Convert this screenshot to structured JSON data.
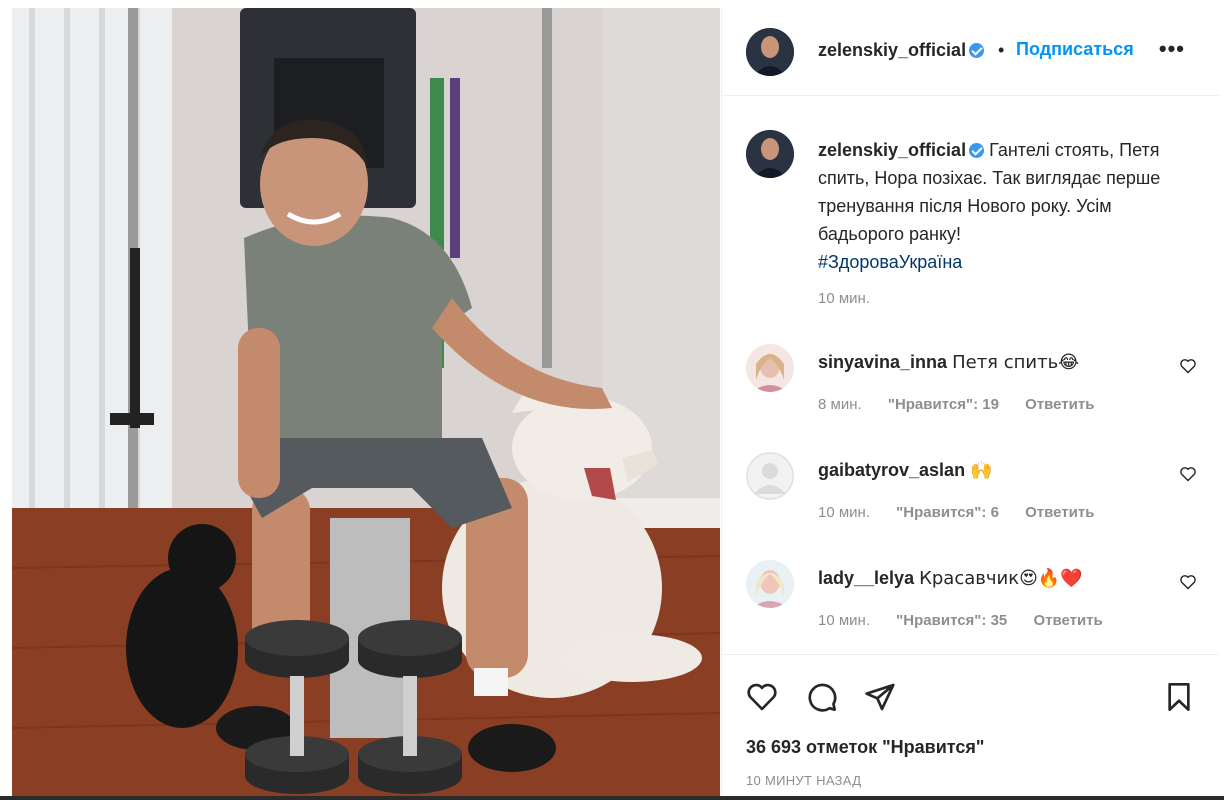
{
  "post": {
    "username": "zelenskiy_official",
    "separator": "•",
    "follow_label": "Подписаться",
    "more_label": "•••"
  },
  "caption": {
    "username": "zelenskiy_official",
    "text": "Гантелі стоять, Петя спить, Нора позіхає. Так виглядає перше тренування після Нового року. Усім бадьорого ранку!",
    "hashtag": "#ЗдороваУкраїна",
    "time": "10 мин."
  },
  "comments": [
    {
      "username": "sinyavina_inna",
      "text": "Петя спить😂",
      "time": "8 мин.",
      "likes": "\"Нравится\": 19",
      "reply": "Ответить"
    },
    {
      "username": "gaibatyrov_aslan",
      "text": "🙌",
      "time": "10 мин.",
      "likes": "\"Нравится\": 6",
      "reply": "Ответить"
    },
    {
      "username": "lady__lelya",
      "text": "Красавчик😍🔥❤️",
      "time": "10 мин.",
      "likes": "\"Нравится\": 35",
      "reply": "Ответить"
    }
  ],
  "footer": {
    "likes": "36 693 отметок \"Нравится\"",
    "posted": "10 МИНУТ НАЗАД"
  },
  "icons": {
    "like": "heart-icon",
    "comment": "comment-icon",
    "share": "paper-plane-icon",
    "save": "bookmark-icon"
  },
  "colors": {
    "follow": "#0095f6",
    "verified": "#3897f0",
    "secondary_text": "#8e8e8e",
    "hashtag": "#00376b"
  }
}
